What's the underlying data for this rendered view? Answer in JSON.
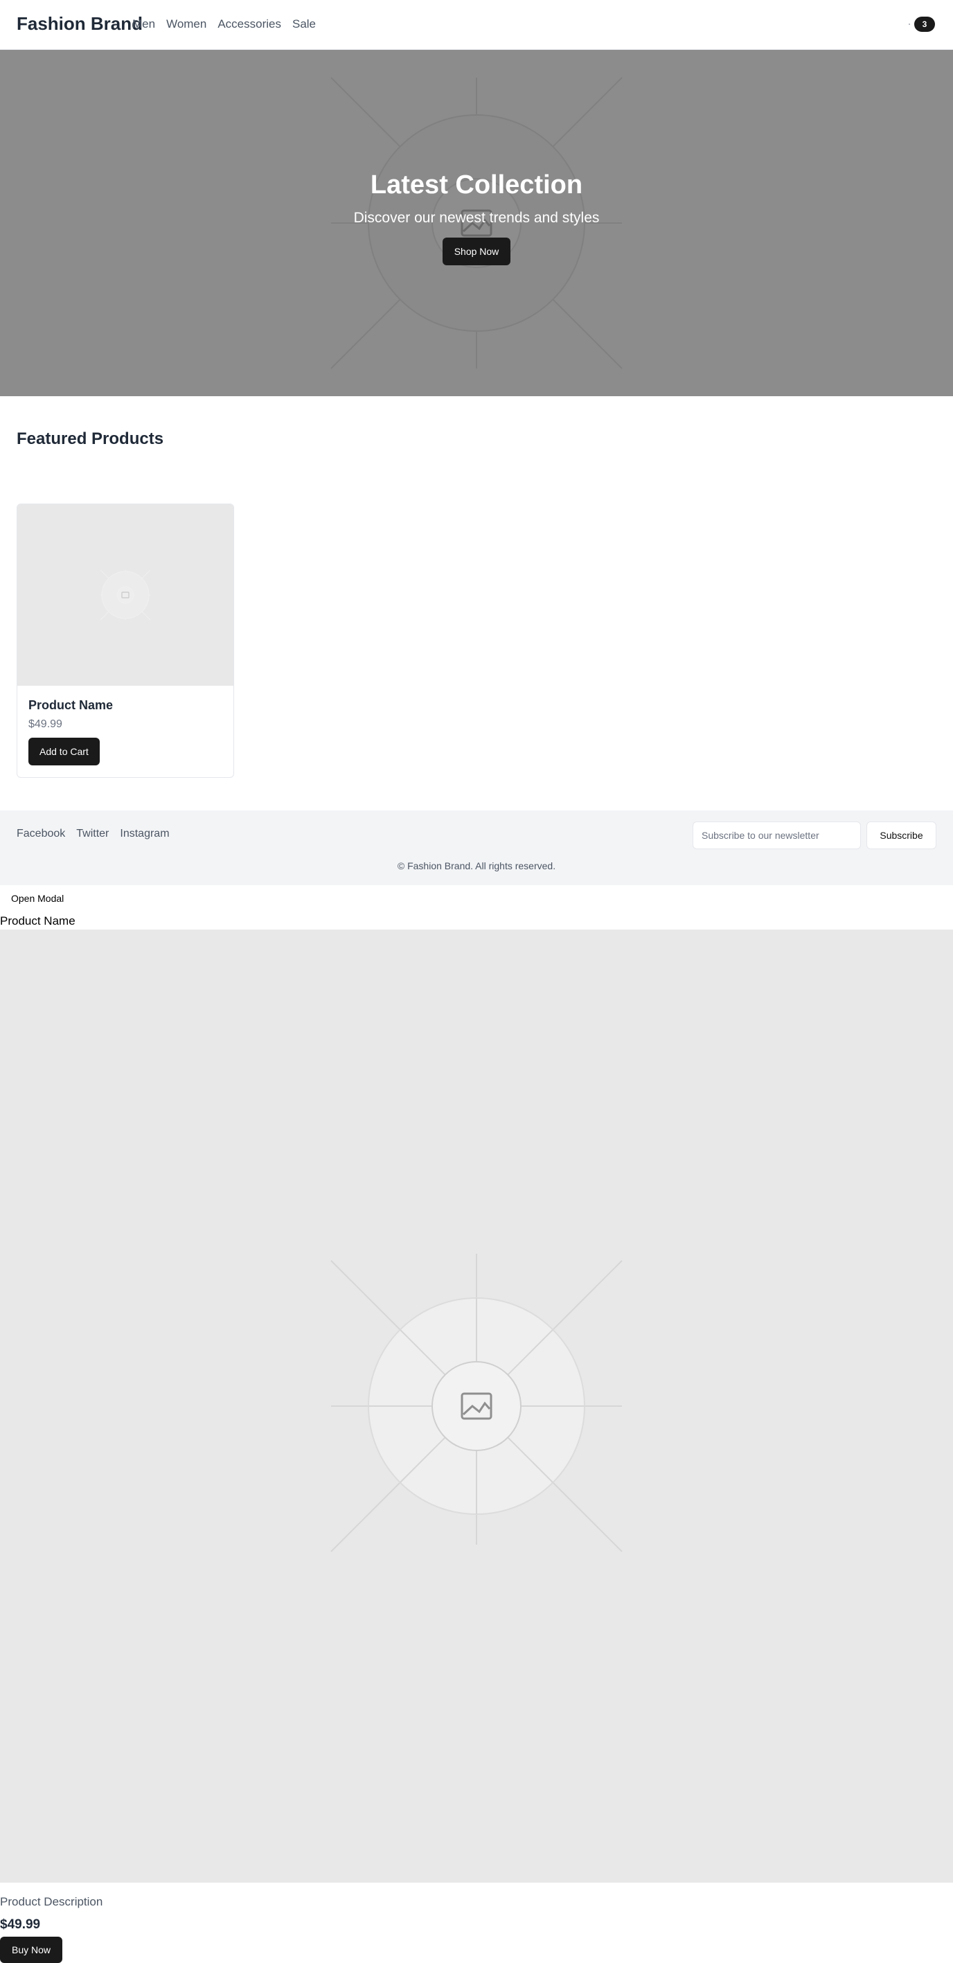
{
  "header": {
    "brand": "Fashion Brand",
    "nav": [
      "Men",
      "Women",
      "Accessories",
      "Sale"
    ],
    "cart_count": "3",
    "cart_icon": "cart-icon"
  },
  "hero": {
    "title": "Latest Collection",
    "subtitle": "Discover our newest trends and styles",
    "cta": "Shop Now",
    "image_icon": "image-placeholder-icon"
  },
  "featured": {
    "title": "Featured Products",
    "products": [
      {
        "name": "Product Name",
        "price": "$49.99",
        "button": "Add to Cart"
      }
    ]
  },
  "footer": {
    "social": [
      "Facebook",
      "Twitter",
      "Instagram"
    ],
    "newsletter_placeholder": "Subscribe to our newsletter",
    "subscribe_label": "Subscribe",
    "copyright": "© Fashion Brand. All rights reserved."
  },
  "modal": {
    "open_label": "Open Modal",
    "product_name": "Product Name",
    "description": "Product Description",
    "price": "$49.99",
    "buy_label": "Buy Now"
  },
  "colors": {
    "primary_button": "#1a1a1a",
    "hero_bg": "#8c8c8c",
    "placeholder_bg": "#e8e8e8",
    "footer_bg": "#f3f4f6"
  }
}
